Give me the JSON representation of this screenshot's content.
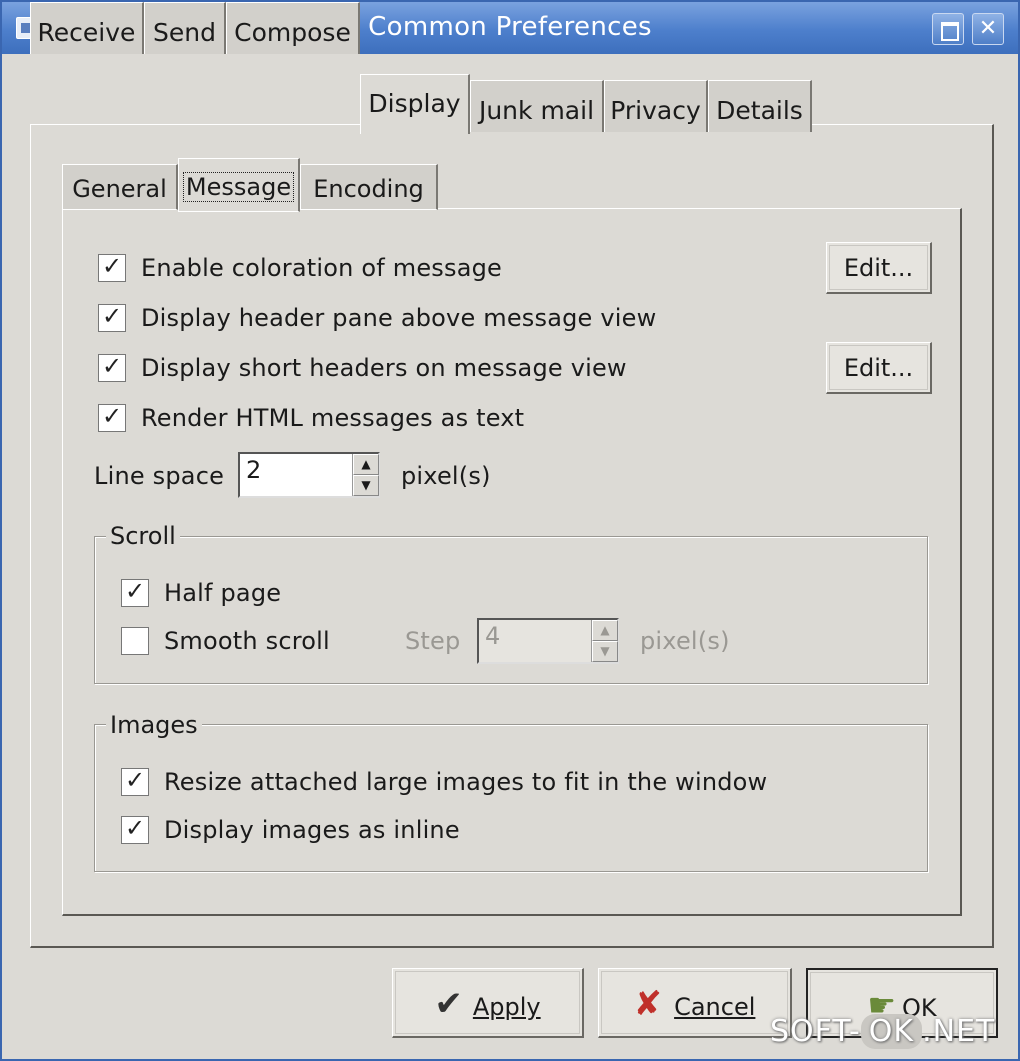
{
  "window": {
    "title": "Common Preferences"
  },
  "outer_tabs": [
    "Receive",
    "Send",
    "Compose",
    "Display",
    "Junk mail",
    "Privacy",
    "Details"
  ],
  "inner_tabs": [
    "General",
    "Message",
    "Encoding"
  ],
  "options": {
    "enable_coloration": {
      "label": "Enable coloration of message",
      "checked": true
    },
    "display_header_pane": {
      "label": "Display header pane above message view",
      "checked": true
    },
    "display_short_headers": {
      "label": "Display short headers on message view",
      "checked": true
    },
    "render_html_as_text": {
      "label": "Render HTML messages as text",
      "checked": true
    },
    "edit_label": "Edit..."
  },
  "line_space": {
    "label": "Line space",
    "value": "2",
    "unit": "pixel(s)"
  },
  "scroll": {
    "title": "Scroll",
    "half_page": {
      "label": "Half page",
      "checked": true
    },
    "smooth_scroll": {
      "label": "Smooth scroll",
      "checked": false
    },
    "step_label": "Step",
    "step_value": "4",
    "step_unit": "pixel(s)"
  },
  "images": {
    "title": "Images",
    "resize": {
      "label": "Resize attached large images to fit in the window",
      "checked": true
    },
    "inline": {
      "label": "Display images as inline",
      "checked": true
    }
  },
  "footer": {
    "apply": "Apply",
    "cancel": "Cancel",
    "ok": "OK"
  },
  "watermark": {
    "left": "SOFT",
    "middle": "OK",
    "right": ".NET"
  }
}
